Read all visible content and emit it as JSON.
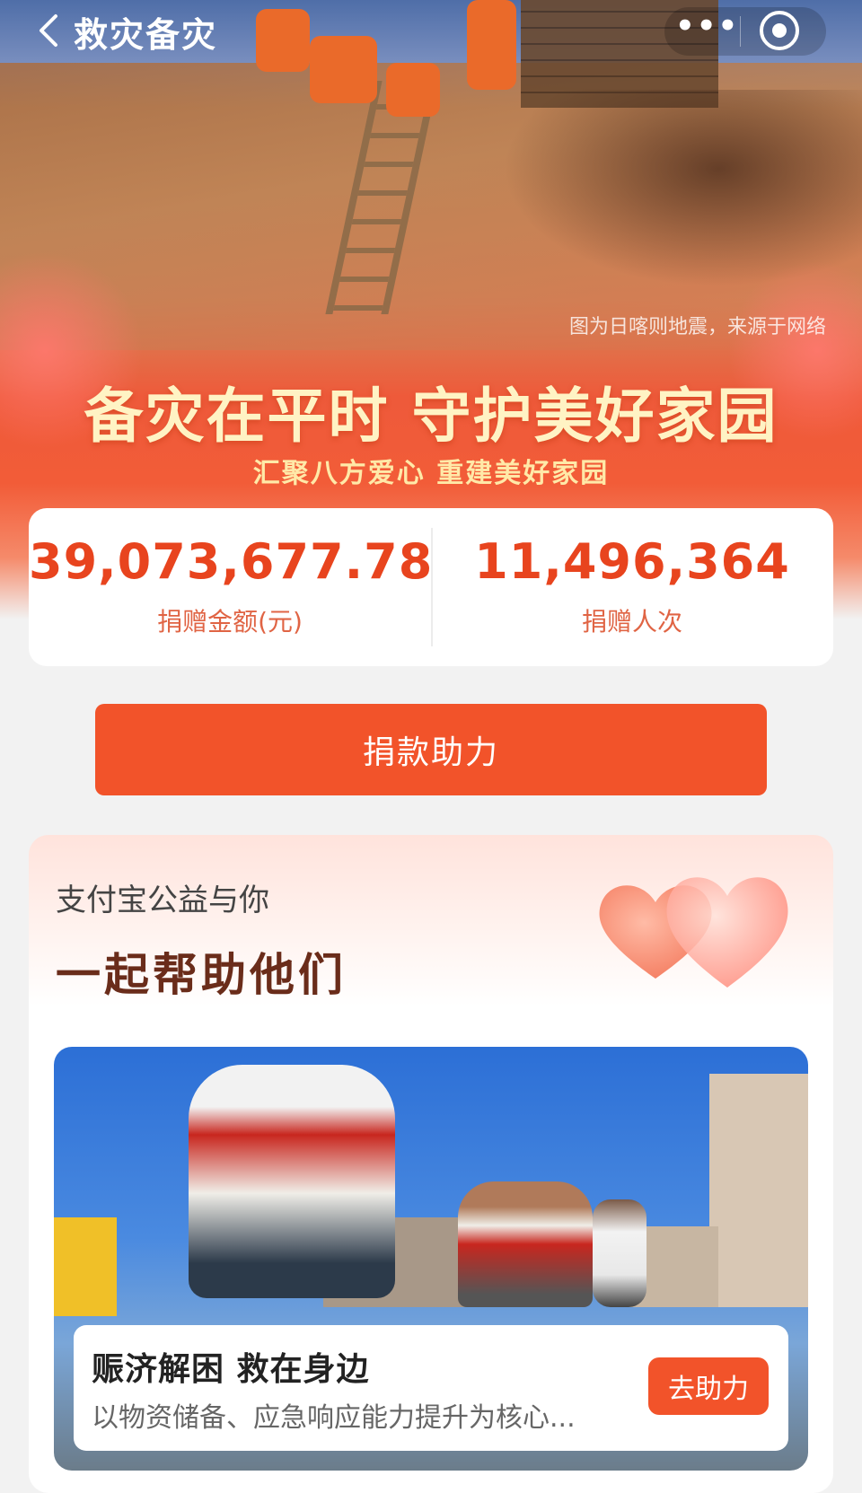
{
  "header": {
    "title": "救灾备灾",
    "more_label": "•••"
  },
  "hero": {
    "image_caption": "图为日喀则地震，来源于网络",
    "slogan": "备灾在平时 守护美好家园",
    "sub_slogan": "汇聚八方爱心 重建美好家园"
  },
  "stats": {
    "amount": {
      "value": "39,073,677.78",
      "label": "捐赠金额(元)"
    },
    "count": {
      "value": "11,496,364",
      "label": "捐赠人次"
    }
  },
  "donate_button": {
    "label": "捐款助力"
  },
  "promo": {
    "small_title": "支付宝公益与你",
    "big_title": "一起帮助他们",
    "project": {
      "title": "赈济解困 救在身边",
      "description": "以物资储备、应急响应能力提升为核心...",
      "button_label": "去助力"
    }
  },
  "colors": {
    "accent": "#f2532a",
    "stat_number": "#e8441e",
    "heading_brown": "#6a2c1a"
  }
}
